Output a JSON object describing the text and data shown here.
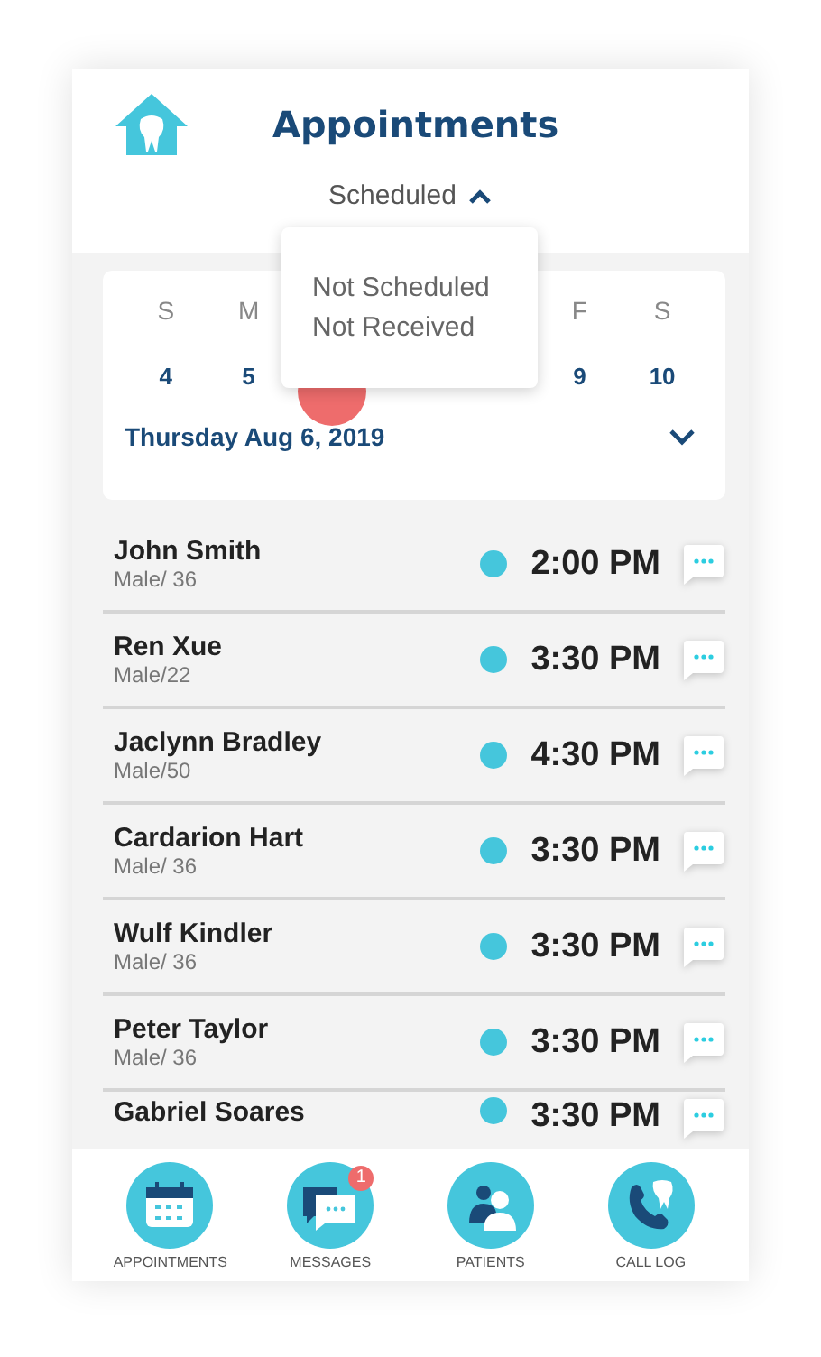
{
  "header": {
    "title": "Appointments",
    "filter": {
      "label": "Scheduled",
      "expanded": true
    }
  },
  "dropdown": {
    "options": [
      "Not Scheduled",
      "Not Received"
    ]
  },
  "calendar": {
    "weekdays": [
      "S",
      "M",
      "F",
      "S"
    ],
    "dates": [
      {
        "label": "4",
        "selected": false
      },
      {
        "label": "5",
        "selected": false
      },
      {
        "selected": true
      },
      {
        "label": "9",
        "selected": false
      },
      {
        "label": "10",
        "selected": false
      }
    ],
    "date_label": "Thursday Aug 6, 2019"
  },
  "appointments": [
    {
      "name": "John Smith",
      "details": "Male/ 36",
      "time": "2:00 PM"
    },
    {
      "name": "Ren Xue",
      "details": "Male/22",
      "time": "3:30 PM"
    },
    {
      "name": "Jaclynn Bradley",
      "details": "Male/50",
      "time": "4:30 PM"
    },
    {
      "name": "Cardarion Hart",
      "details": "Male/ 36",
      "time": "3:30 PM"
    },
    {
      "name": "Wulf Kindler",
      "details": "Male/ 36",
      "time": "3:30 PM"
    },
    {
      "name": "Peter Taylor",
      "details": "Male/ 36",
      "time": "3:30 PM"
    },
    {
      "name": "Gabriel Soares",
      "time": "3:30 PM"
    }
  ],
  "nav": [
    {
      "kind": "calendar",
      "label": "APPOINTMENTS"
    },
    {
      "kind": "messages",
      "label": "MESSAGES",
      "badge": "1"
    },
    {
      "kind": "patients",
      "label": "PATIENTS"
    },
    {
      "kind": "calllog",
      "label": "CALL LOG"
    }
  ]
}
